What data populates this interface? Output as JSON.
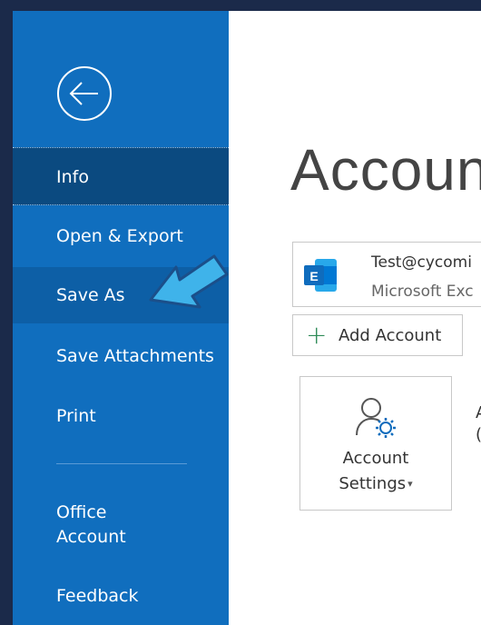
{
  "sidebar": {
    "back_icon": "back-arrow-icon",
    "items": [
      {
        "label": "Info",
        "state": "selected"
      },
      {
        "label": "Open & Export"
      },
      {
        "label": "Save As",
        "state": "highlighted"
      },
      {
        "label": "Save Attachments"
      },
      {
        "label": "Print"
      },
      {
        "label": "Office\nAccount"
      },
      {
        "label": "Feedback"
      }
    ],
    "office_line1": "Office",
    "office_line2": "Account"
  },
  "main": {
    "title": "Accoun",
    "account": {
      "email": "Test@cycomi",
      "type": "Microsoft Exc",
      "icon": "exchange-icon"
    },
    "add_account_label": "Add Account",
    "settings_tile": {
      "line1": "Account",
      "line2": "Settings",
      "icon": "account-settings-icon"
    },
    "clipped_text": [
      "A",
      "("
    ]
  },
  "colors": {
    "sidebar_bg": "#106ebe",
    "sidebar_selected": "#0b4a80",
    "sidebar_hover": "#0d5fa6",
    "annotation_arrow": "#3fb3ea",
    "add_plus": "#2e8b57",
    "exchange_blue": "#0f6cbd"
  },
  "annotation": {
    "icon": "pointer-arrow-icon",
    "points_to": "Save As"
  }
}
